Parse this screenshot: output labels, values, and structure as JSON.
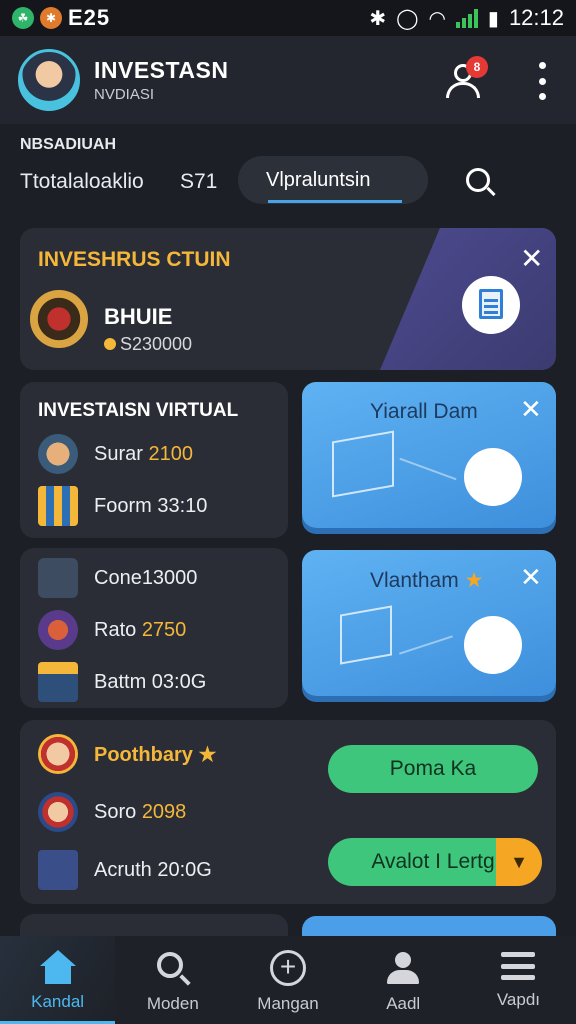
{
  "status_bar": {
    "num": "E25",
    "time": "12:12"
  },
  "header": {
    "title": "INVESTASN",
    "subtitle": "NVDIASI",
    "notif_badge": "8"
  },
  "section_label": "NBSADIUAH",
  "filter": {
    "total_label": "Ttotalaloaklio",
    "total_value": "S71",
    "pill_label": "Vlpraluntsin"
  },
  "promo": {
    "title": "INVESHRUS CTUIN",
    "name": "BHUIE",
    "amount": "S230000",
    "close": "✕"
  },
  "list1": {
    "title": "INVESTAISN VIRTUAL",
    "items": [
      {
        "label": "Surar",
        "num": "2100"
      },
      {
        "label": "Foorm 33:10",
        "num": ""
      }
    ]
  },
  "blue1": {
    "title": "Yiarall Dam",
    "close": "✕"
  },
  "list2": {
    "items": [
      {
        "label": "Cone13000",
        "num": ""
      },
      {
        "label": "Rato",
        "num": "2750"
      },
      {
        "label": "Battm 03:0G",
        "num": ""
      }
    ]
  },
  "blue2": {
    "title": "Vlantham",
    "close": "✕"
  },
  "list3": {
    "items": [
      {
        "label": "Poothbary",
        "num": ""
      },
      {
        "label": "Soro",
        "num": "2098"
      },
      {
        "label": "Acruth 20:0G",
        "num": ""
      }
    ]
  },
  "buttons": {
    "primary": "Poma Ka",
    "secondary": "Avalot I Lertg",
    "secondary_arrow": "▼"
  },
  "nav": {
    "items": [
      {
        "label": "Kandal",
        "icon": "home-icon"
      },
      {
        "label": "Moden",
        "icon": "search-icon"
      },
      {
        "label": "Mangan",
        "icon": "plus-icon"
      },
      {
        "label": "Aadl",
        "icon": "person-icon"
      },
      {
        "label": "Vapdı",
        "icon": "menu-icon"
      }
    ]
  },
  "colors": {
    "accent_gold": "#f4b73a",
    "accent_blue": "#4db8f0",
    "card_blue": "#4a9fe8",
    "green": "#3ec77c",
    "badge_red": "#e53935"
  }
}
